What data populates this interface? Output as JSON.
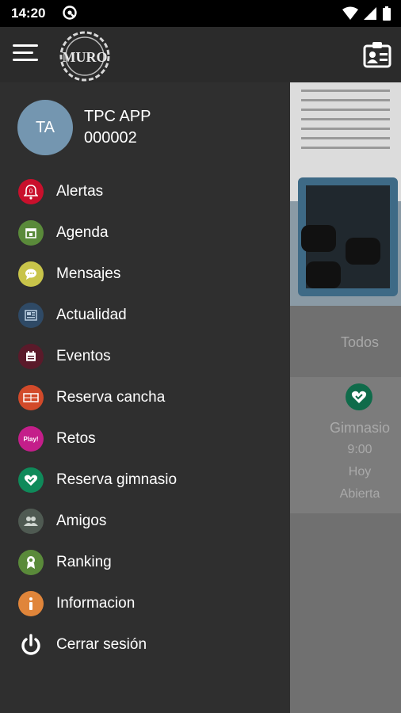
{
  "status": {
    "time": "14:20"
  },
  "header": {
    "logo_text": "MURO"
  },
  "user": {
    "initials": "TA",
    "name": "TPC APP",
    "code": "000002"
  },
  "menu": [
    {
      "label": "Alertas",
      "icon": "bell-icon",
      "color": "#c9102c"
    },
    {
      "label": "Agenda",
      "icon": "calendar-icon",
      "color": "#5a8a3a"
    },
    {
      "label": "Mensajes",
      "icon": "chat-icon",
      "color": "#c8c44a"
    },
    {
      "label": "Actualidad",
      "icon": "news-icon",
      "color": "#2f4a66"
    },
    {
      "label": "Eventos",
      "icon": "event-icon",
      "color": "#5a1a2a"
    },
    {
      "label": "Reserva cancha",
      "icon": "court-icon",
      "color": "#d24a2a"
    },
    {
      "label": "Retos",
      "icon": "play-icon",
      "color": "#c41e8a",
      "badge": "Play!"
    },
    {
      "label": "Reserva gimnasio",
      "icon": "gym-heart-icon",
      "color": "#0f8a5a"
    },
    {
      "label": "Amigos",
      "icon": "friends-icon",
      "color": "#4f5a52"
    },
    {
      "label": "Ranking",
      "icon": "ranking-icon",
      "color": "#5a8a3a"
    },
    {
      "label": "Informacion",
      "icon": "info-icon",
      "color": "#e0853a"
    },
    {
      "label": "Cerrar sesión",
      "icon": "power-icon",
      "color": "#ffffff"
    }
  ],
  "background": {
    "tab": "Todos",
    "card": {
      "title": "Gimnasio",
      "time": "9:00",
      "day": "Hoy",
      "status": "Abierta"
    }
  }
}
